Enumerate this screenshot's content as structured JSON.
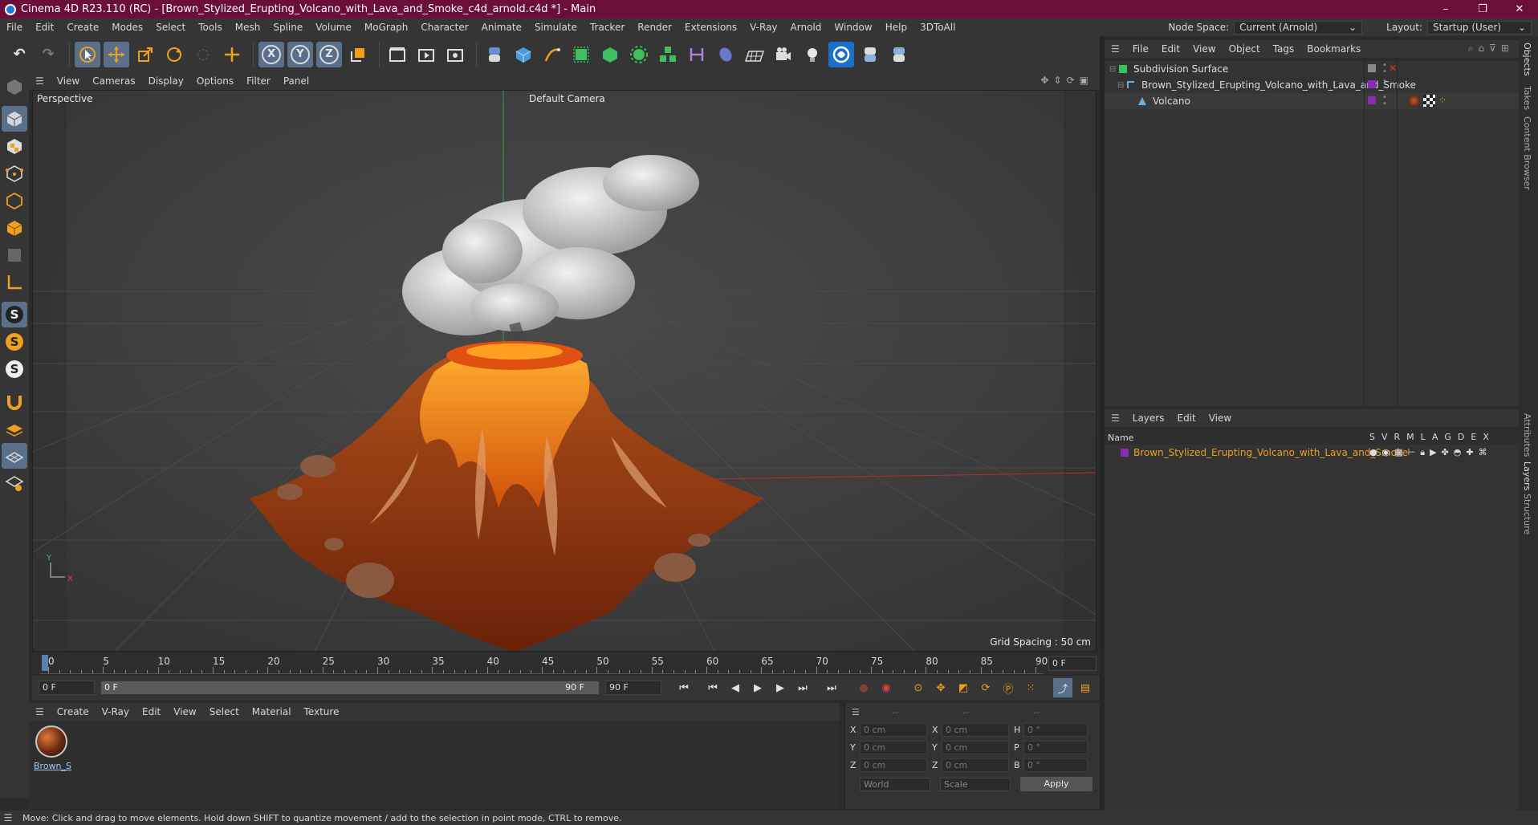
{
  "window": {
    "title": "Cinema 4D R23.110 (RC) - [Brown_Stylized_Erupting_Volcano_with_Lava_and_Smoke_c4d_arnold.c4d *] - Main",
    "controls": [
      "–",
      "❐",
      "✕"
    ]
  },
  "menubar": {
    "items": [
      "File",
      "Edit",
      "Create",
      "Modes",
      "Select",
      "Tools",
      "Mesh",
      "Spline",
      "Volume",
      "MoGraph",
      "Character",
      "Animate",
      "Simulate",
      "Tracker",
      "Render",
      "Extensions",
      "V-Ray",
      "Arnold",
      "Window",
      "Help",
      "3DToAll"
    ],
    "node_space_label": "Node Space:",
    "node_space_value": "Current (Arnold)",
    "layout_label": "Layout:",
    "layout_value": "Startup (User)"
  },
  "toolbar": {
    "axis_x": "X",
    "axis_y": "Y",
    "axis_z": "Z"
  },
  "viewport": {
    "menu": [
      "View",
      "Cameras",
      "Display",
      "Options",
      "Filter",
      "Panel"
    ],
    "projection": "Perspective",
    "camera": "Default Camera",
    "grid_spacing": "Grid Spacing : 50 cm",
    "axis_y": "Y",
    "axis_x": "X"
  },
  "timeline": {
    "ticks": [
      "0",
      "5",
      "10",
      "15",
      "20",
      "25",
      "30",
      "35",
      "40",
      "45",
      "50",
      "55",
      "60",
      "65",
      "70",
      "75",
      "80",
      "85",
      "90"
    ],
    "current_frame": "0 F"
  },
  "transport": {
    "start_field": "0 F",
    "range_start": "0 F",
    "range_end": "90 F",
    "end_field": "90 F"
  },
  "material_manager": {
    "menu": [
      "Create",
      "V-Ray",
      "Edit",
      "View",
      "Select",
      "Material",
      "Texture"
    ],
    "material_name": "Brown_S"
  },
  "coordinates": {
    "headers": [
      "--",
      "--",
      "--"
    ],
    "rows": [
      {
        "a": "X",
        "av": "0 cm",
        "b": "X",
        "bv": "0 cm",
        "c": "H",
        "cv": "0 °"
      },
      {
        "a": "Y",
        "av": "0 cm",
        "b": "Y",
        "bv": "0 cm",
        "c": "P",
        "cv": "0 °"
      },
      {
        "a": "Z",
        "av": "0 cm",
        "b": "Z",
        "bv": "0 cm",
        "c": "B",
        "cv": "0 °"
      }
    ],
    "space": "World",
    "mode": "Scale",
    "apply": "Apply"
  },
  "object_manager": {
    "menu": [
      "File",
      "Edit",
      "View",
      "Object",
      "Tags",
      "Bookmarks"
    ],
    "objects": [
      {
        "name": "Subdivision Surface",
        "indent": 0
      },
      {
        "name": "Brown_Stylized_Erupting_Volcano_with_Lava_and_Smoke",
        "indent": 1
      },
      {
        "name": "Volcano",
        "indent": 2
      }
    ]
  },
  "layers": {
    "menu": [
      "Layers",
      "Edit",
      "View"
    ],
    "name_header": "Name",
    "columns": [
      "S",
      "V",
      "R",
      "M",
      "L",
      "A",
      "G",
      "D",
      "E",
      "X"
    ],
    "items": [
      {
        "name": "Brown_Stylized_Erupting_Volcano_with_Lava_and_Smoke"
      }
    ]
  },
  "side_tabs": [
    "Objects",
    "Takes",
    "Content Browser",
    "Attributes",
    "Layers",
    "Structure"
  ],
  "status": {
    "message": "Move: Click and drag to move elements. Hold down SHIFT to quantize movement / add to the selection in point mode, CTRL to remove."
  },
  "colors": {
    "title_bar": "#6b0f3a",
    "accent_active": "#5a6f8a",
    "layer_color": "#8a2ab8",
    "layer_text": "#f0a020"
  }
}
